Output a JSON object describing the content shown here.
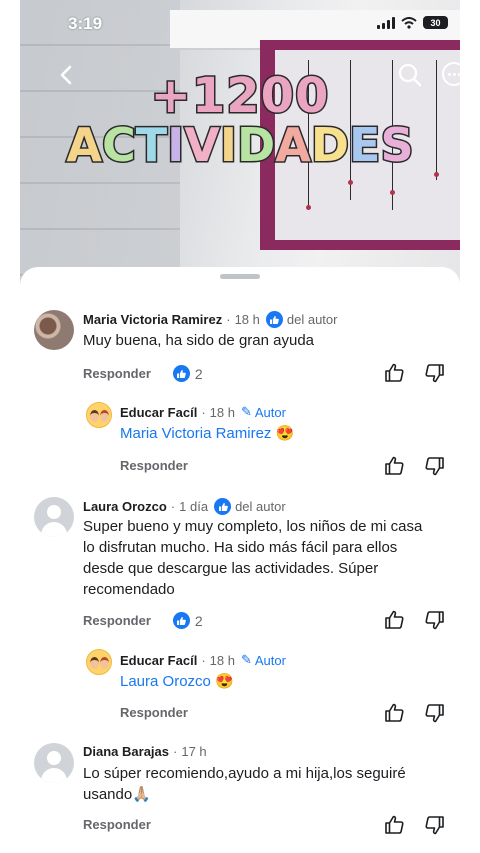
{
  "status_bar": {
    "time": "3:19",
    "battery": "30"
  },
  "video": {
    "title_line1": "+1200",
    "title_line2_letters": [
      {
        "ch": "A",
        "color": "#f4d38a"
      },
      {
        "ch": "C",
        "color": "#b8e3a3"
      },
      {
        "ch": "T",
        "color": "#9fd8e8"
      },
      {
        "ch": "I",
        "color": "#c8b3e8"
      },
      {
        "ch": "V",
        "color": "#f1b0c6"
      },
      {
        "ch": "I",
        "color": "#f4d38a"
      },
      {
        "ch": "D",
        "color": "#b8e3a3"
      },
      {
        "ch": "A",
        "color": "#f2a9a0"
      },
      {
        "ch": "D",
        "color": "#f7e08e"
      },
      {
        "ch": "E",
        "color": "#a9c8f0"
      },
      {
        "ch": "S",
        "color": "#e8b0d8"
      }
    ],
    "icons": {
      "back": "chevron-left-icon",
      "search": "search-icon",
      "more": "more-dots-icon"
    }
  },
  "comments": [
    {
      "name": "Maria Victoria Ramirez",
      "time": "18 h",
      "badge": "del autor",
      "text": "Muy buena, ha sido de gran ayuda",
      "reply_label": "Responder",
      "likes": "2",
      "reply": {
        "name": "Educar Facíl",
        "time": "18 h",
        "author_label": "Autor",
        "mention": "Maria Victoria Ramirez",
        "emoji": "😍",
        "reply_label": "Responder"
      }
    },
    {
      "name": "Laura Orozco",
      "time": "1 día",
      "badge": "del autor",
      "text_lines": [
        "Super bueno y muy completo, los niños de mi casa",
        "lo disfrutan mucho. Ha sido más fácil para ellos",
        "desde que descargue las actividades. Súper",
        "recomendado"
      ],
      "reply_label": "Responder",
      "likes": "2",
      "reply": {
        "name": "Educar Facíl",
        "time": "18 h",
        "author_label": "Autor",
        "mention": "Laura Orozco",
        "emoji": "😍",
        "reply_label": "Responder"
      }
    },
    {
      "name": "Diana Barajas",
      "time": "17 h",
      "text_lines": [
        "Lo súper recomiendo,ayudo a mi hija,los seguiré",
        "usando🙏🏼"
      ],
      "reply_label": "Responder"
    }
  ],
  "colors": {
    "accent": "#1877f2",
    "muted": "#65676b",
    "text": "#1c1e21"
  }
}
